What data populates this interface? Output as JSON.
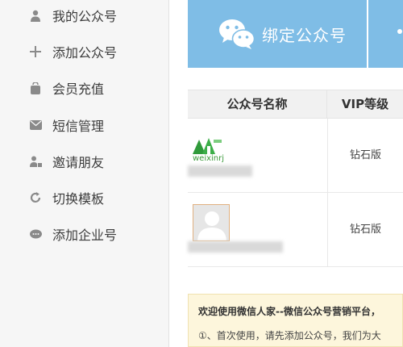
{
  "sidebar": {
    "items": [
      {
        "label": "我的公众号",
        "icon": "user-icon"
      },
      {
        "label": "添加公众号",
        "icon": "plus-icon"
      },
      {
        "label": "会员充值",
        "icon": "bag-icon"
      },
      {
        "label": "短信管理",
        "icon": "envelope-icon"
      },
      {
        "label": "邀请朋友",
        "icon": "person-invite-icon"
      },
      {
        "label": "切换模板",
        "icon": "refresh-icon"
      },
      {
        "label": "添加企业号",
        "icon": "chat-icon"
      }
    ]
  },
  "main": {
    "bind_tile": {
      "label": "绑定公众号",
      "icon": "wechat-icon",
      "color": "#7fbde6"
    },
    "table": {
      "headers": [
        "公众号名称",
        "VIP等级"
      ],
      "rows": [
        {
          "logo_text": "weixinrj",
          "vip": "钻石版"
        },
        {
          "vip": "钻石版"
        }
      ]
    },
    "notice": {
      "line1": "欢迎使用微信人家--微信公众号营销平台，",
      "line2": "①、首次使用，请先添加公众号，我们为大"
    }
  }
}
